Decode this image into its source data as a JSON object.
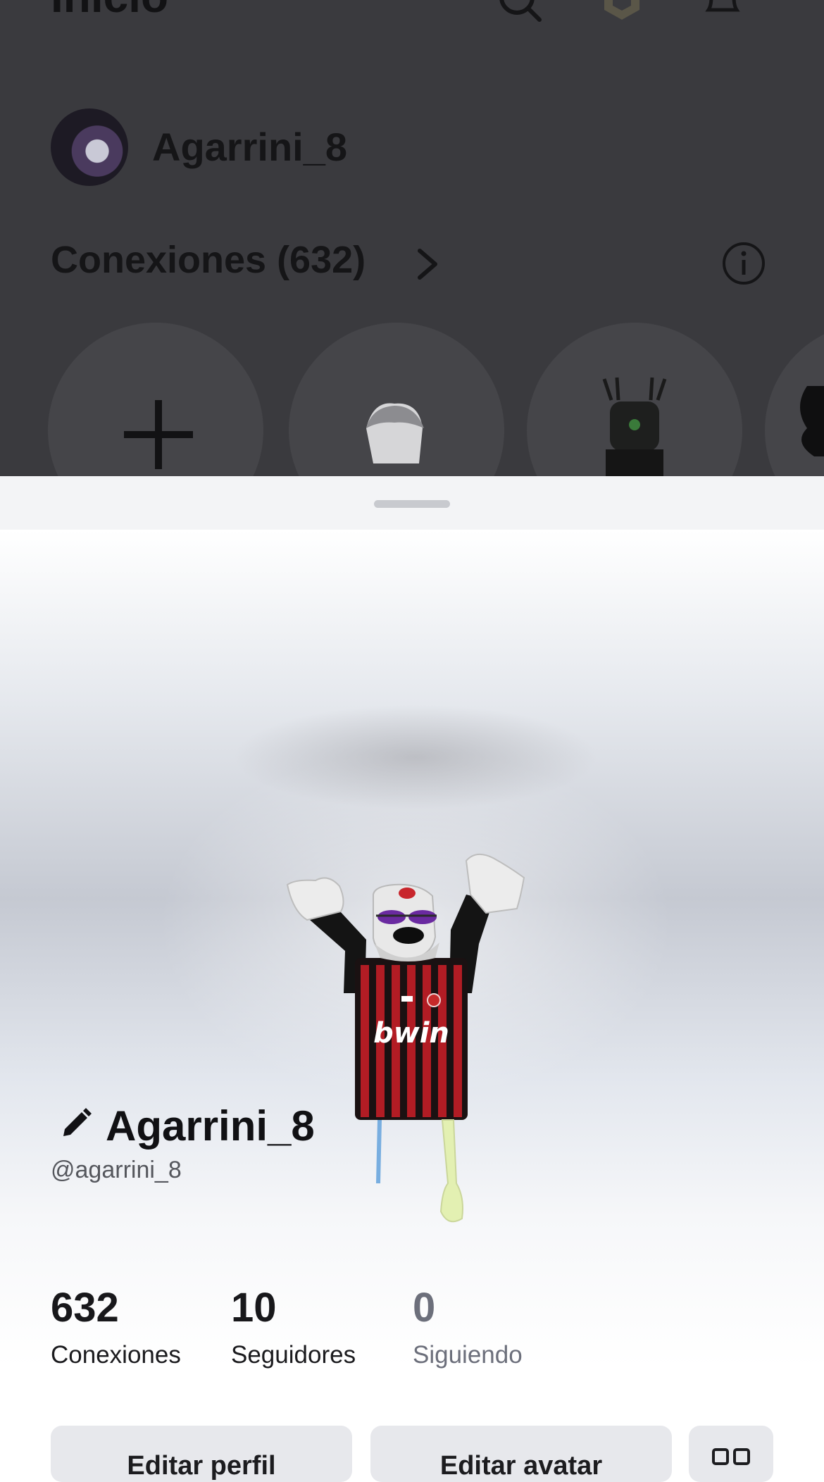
{
  "background": {
    "title": "Inicio",
    "user_name": "Agarrini_8",
    "connections_title": "Conexiones (632)"
  },
  "profile": {
    "display_name": "Agarrini_8",
    "handle": "@agarrini_8",
    "stats": [
      {
        "value": "632",
        "label": "Conexiones"
      },
      {
        "value": "10",
        "label": "Seguidores"
      },
      {
        "value": "0",
        "label": "Siguiendo"
      }
    ],
    "jersey_text": "bwin"
  },
  "actions": {
    "edit_profile": "Editar perfil",
    "edit_avatar": "Editar avatar"
  },
  "colors": {
    "overlay": "#3a3a3e",
    "button_bg": "#e7e8ec",
    "muted_text": "#6c6f7b"
  }
}
